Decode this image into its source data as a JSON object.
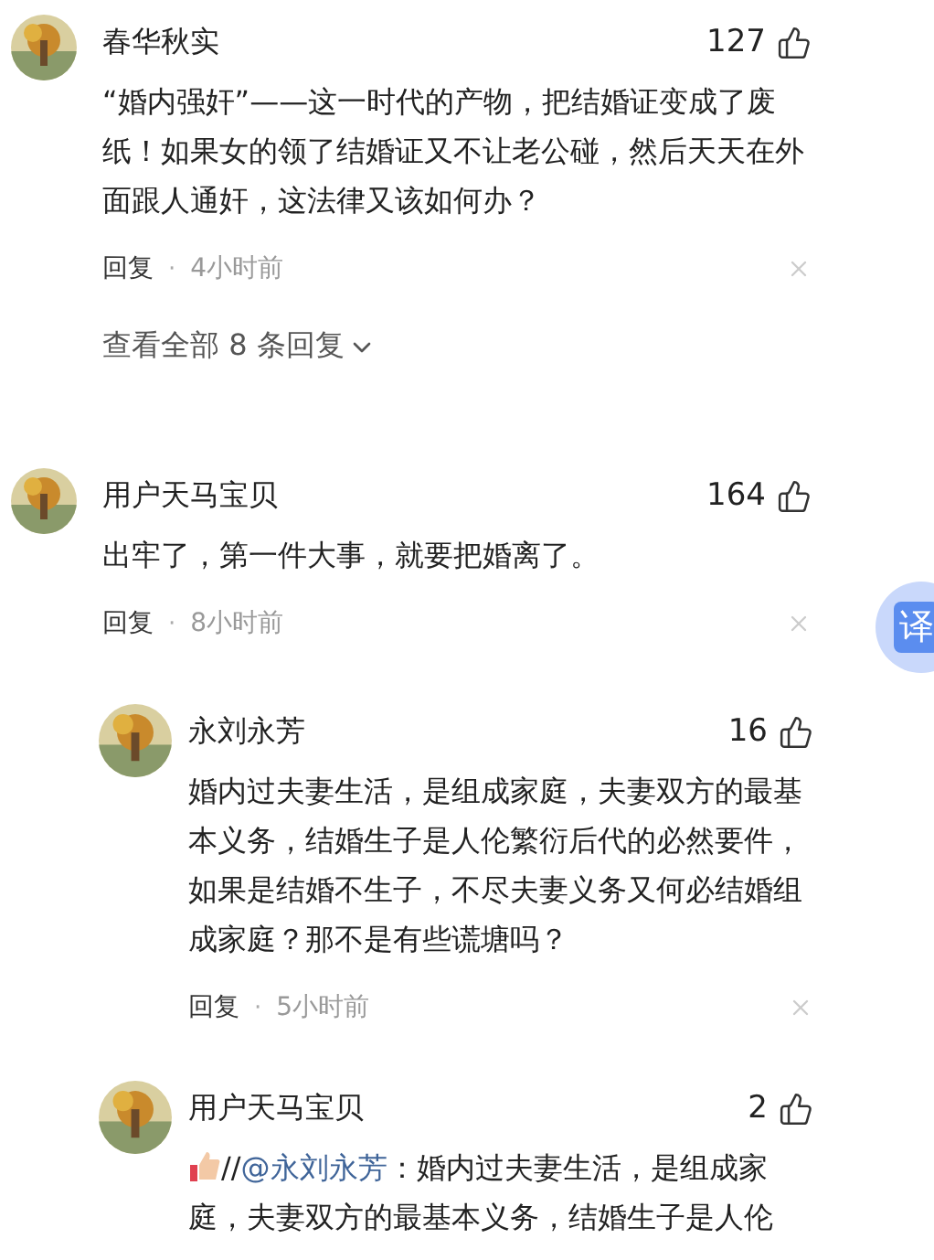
{
  "comments": [
    {
      "author": "春华秋实",
      "likes": "127",
      "segments": [
        {
          "kind": "text",
          "text": "“婚内强奸”——这一时代的产物，把结婚证变成了废纸！如果女的领了结婚证又不让老公碰，然后天天在外面跟人通奸，这法律又该如何办？"
        }
      ],
      "reply_label": "回复",
      "separator": "·",
      "time": "4小时前",
      "view_all": "查看全部 8 条回复"
    },
    {
      "author": "用户天马宝贝",
      "likes": "164",
      "segments": [
        {
          "kind": "text",
          "text": "出牢了，第一件大事，就要把婚离了。"
        }
      ],
      "reply_label": "回复",
      "separator": "·",
      "time": "8小时前",
      "replies": [
        {
          "author": "永刘永芳",
          "likes": "16",
          "segments": [
            {
              "kind": "text",
              "text": "婚内过夫妻生活，是组成家庭，夫妻双方的最基本义务，结婚生子是人伦繁衍后代的必然要件，如果是结婚不生子，不尽夫妻义务又何必结婚组成家庭？那不是有些谎塘吗？"
            }
          ],
          "reply_label": "回复",
          "separator": "·",
          "time": "5小时前"
        },
        {
          "author": "用户天马宝贝",
          "likes": "2",
          "segments": [
            {
              "kind": "emoji"
            },
            {
              "kind": "text",
              "text": "//"
            },
            {
              "kind": "mention",
              "text": "@永刘永芳"
            },
            {
              "kind": "text",
              "text": "：婚内过夫妻生活，是组成家庭，夫妻双方的最基本义务，结婚生子是人伦"
            }
          ]
        }
      ]
    }
  ],
  "translate_button": "译"
}
